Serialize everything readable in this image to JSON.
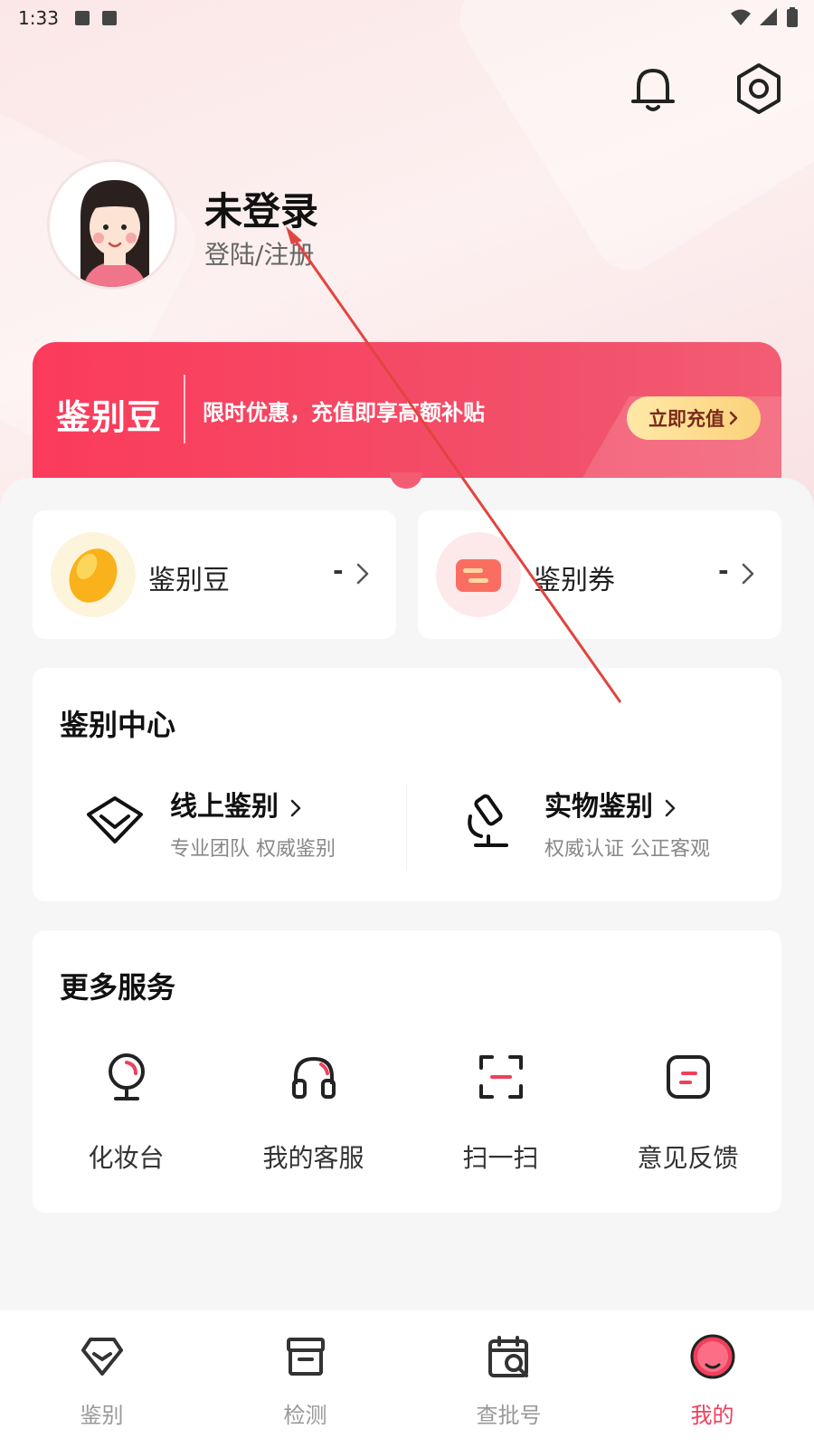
{
  "status_bar": {
    "time": "1:33"
  },
  "header": {
    "username": "未登录",
    "login_link": "登陆/注册"
  },
  "promo": {
    "logo": "鉴别豆",
    "text": "限时优惠，充值即享高额补贴",
    "button": "立即充值"
  },
  "assets": [
    {
      "label": "鉴别豆",
      "value": "-"
    },
    {
      "label": "鉴别券",
      "value": "-"
    }
  ],
  "center": {
    "title": "鉴别中心",
    "items": [
      {
        "label": "线上鉴别",
        "sub": "专业团队 权威鉴别"
      },
      {
        "label": "实物鉴别",
        "sub": "权威认证 公正客观"
      }
    ]
  },
  "services": {
    "title": "更多服务",
    "items": [
      {
        "label": "化妆台",
        "icon": "mirror-icon"
      },
      {
        "label": "我的客服",
        "icon": "headset-icon"
      },
      {
        "label": "扫一扫",
        "icon": "scan-icon"
      },
      {
        "label": "意见反馈",
        "icon": "feedback-icon"
      }
    ]
  },
  "tabs": [
    {
      "label": "鉴别",
      "icon": "diamond-icon",
      "active": false
    },
    {
      "label": "检测",
      "icon": "box-icon",
      "active": false
    },
    {
      "label": "查批号",
      "icon": "calendar-search-icon",
      "active": false
    },
    {
      "label": "我的",
      "icon": "profile-icon",
      "active": true
    }
  ],
  "colors": {
    "accent": "#f03f5c",
    "promo": "#fb3b5b",
    "button_gold": "#fbd27a"
  }
}
